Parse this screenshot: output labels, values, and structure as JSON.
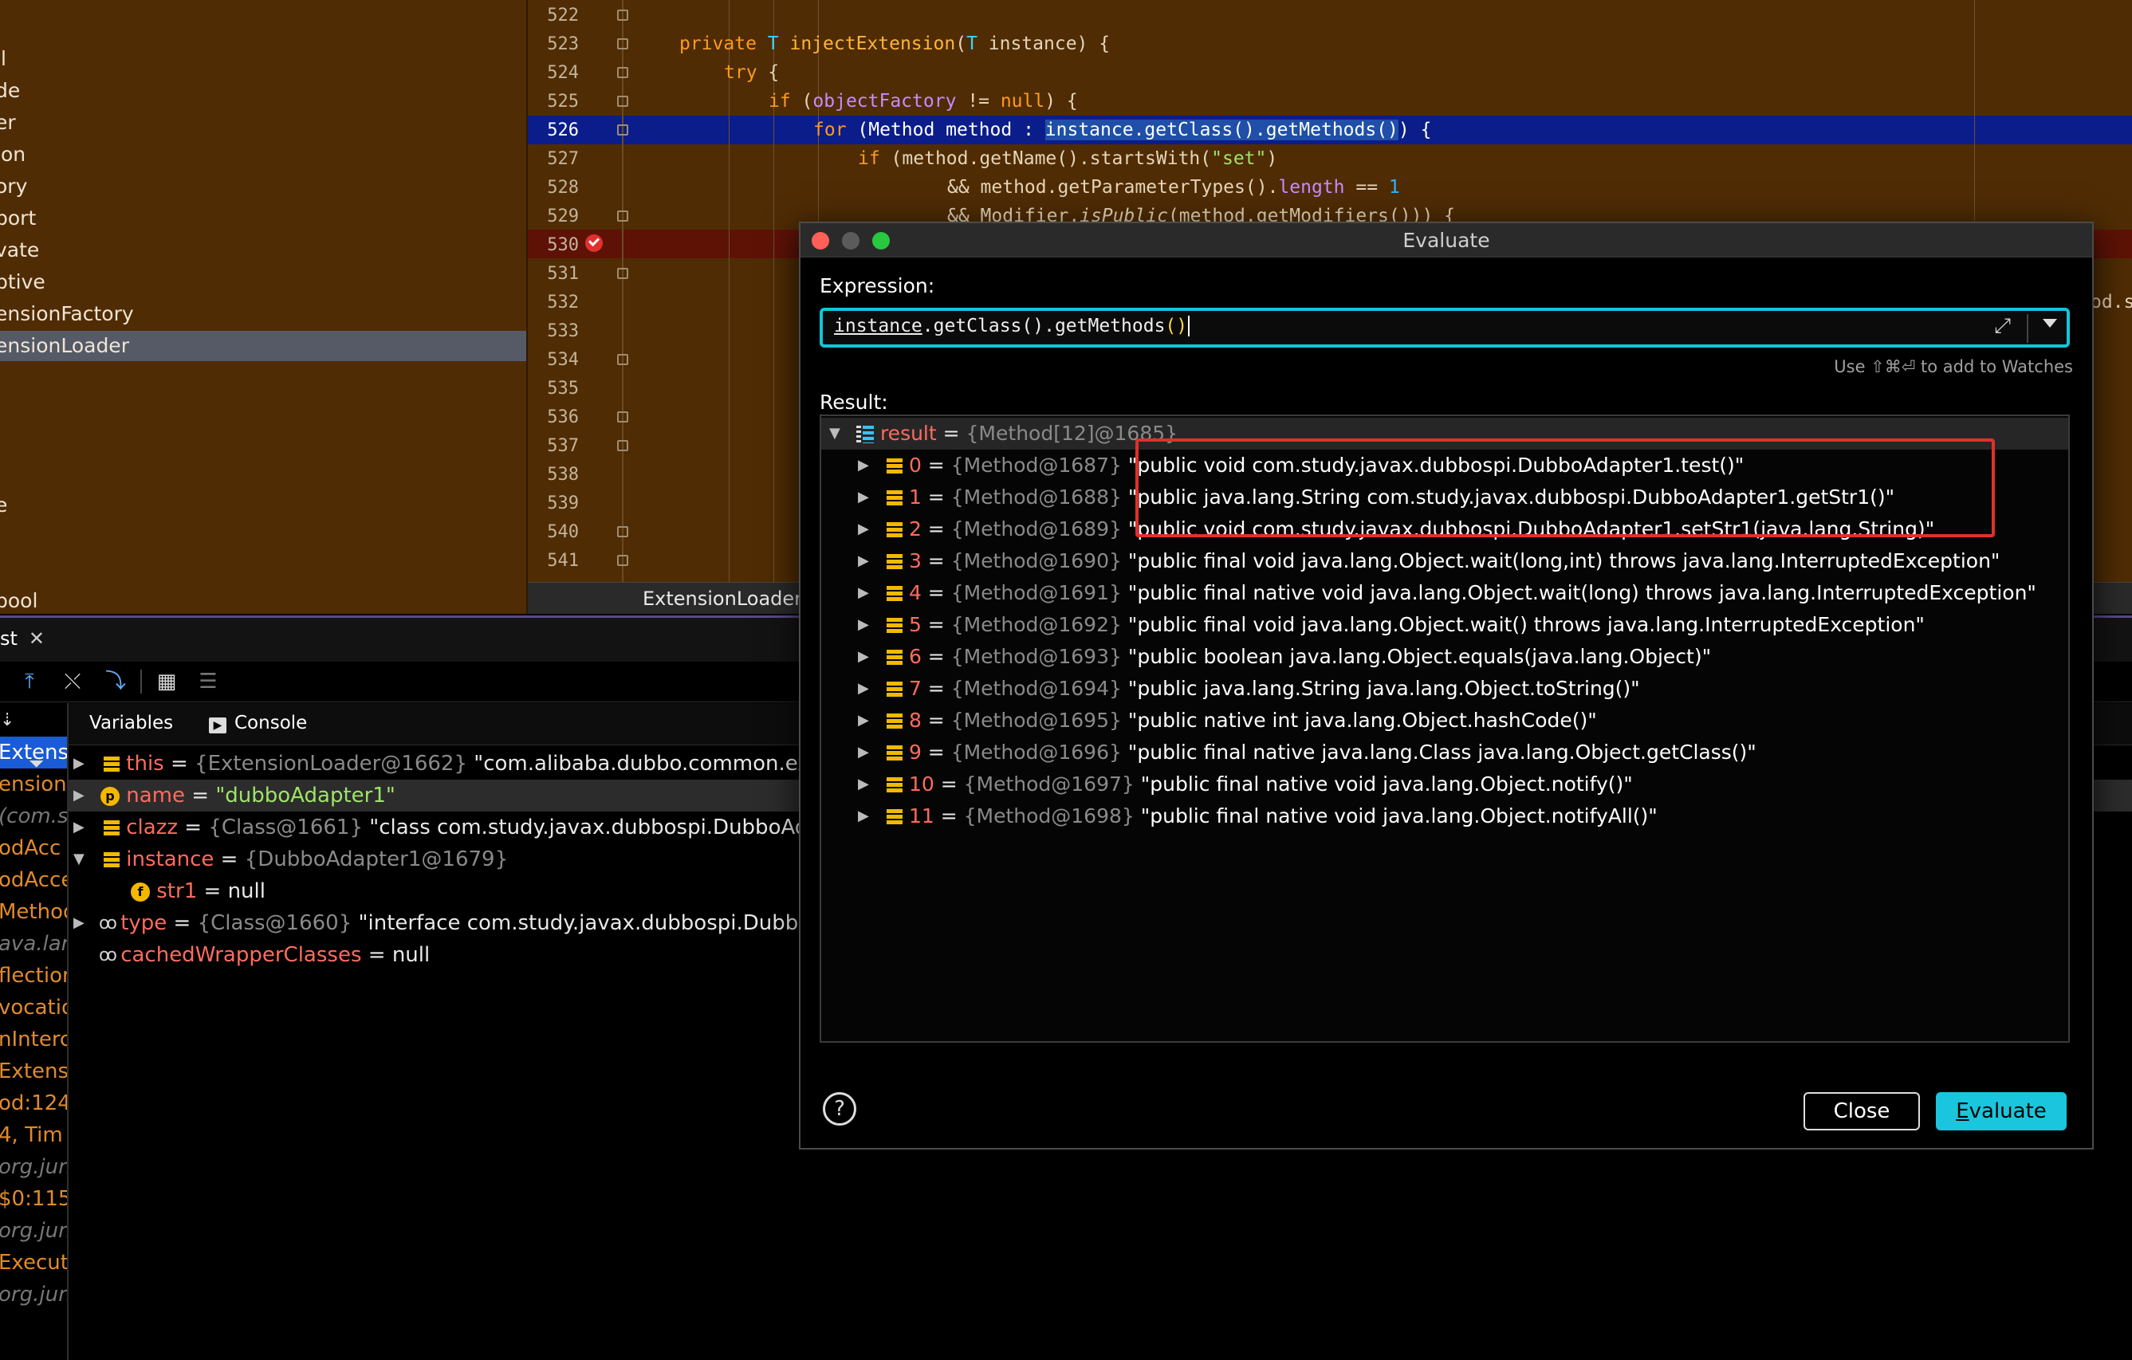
{
  "project_tree": {
    "items": [
      {
        "label": "il"
      },
      {
        "label": "de"
      },
      {
        "label": "er"
      },
      {
        "label": "ion"
      },
      {
        "label": "ory"
      },
      {
        "label": "port"
      },
      {
        "label": "vate"
      },
      {
        "label": "ptive"
      },
      {
        "label": "ensionFactory"
      },
      {
        "label": "ensionLoader"
      },
      {
        "label": "e"
      },
      {
        "label": "pool"
      }
    ]
  },
  "editor": {
    "line_numbers": [
      "522",
      "523",
      "524",
      "525",
      "526",
      "527",
      "528",
      "529",
      "530",
      "531",
      "532",
      "533",
      "534",
      "535",
      "536",
      "537",
      "538",
      "539",
      "540",
      "541"
    ],
    "lines": {
      "l523": {
        "kw1": "private ",
        "ty1": "T ",
        "fn": "injectExtension",
        "p1": "(",
        "ty2": "T",
        "rest": " instance) {"
      },
      "l524": {
        "kw": "try",
        "rest": " {"
      },
      "l525": {
        "kw": "if",
        "a": " (",
        "fld": "objectFactory",
        "b": " != ",
        "kw2": "null",
        "c": ") {"
      },
      "l526": {
        "kw": "for",
        "a": " (Method method : ",
        "sel": "instance.getClass().getMethods()",
        "b": ") {"
      },
      "l527": {
        "kw": "if",
        "a": " (method.getName().startsWith(",
        "str": "\"set\"",
        "b": ")"
      },
      "l528": {
        "a": "&& method.getParameterTypes().",
        "fld": "length",
        "b": " == ",
        "num": "1"
      },
      "l529": {
        "a": "&& Modifier.",
        "it": "isPublic",
        "b": "(method.getModifiers())) {"
      }
    },
    "right_clip": "od.s",
    "tab_label": "ExtensionLoader"
  },
  "debug": {
    "tab_label": "st",
    "tabs": {
      "variables": "Variables",
      "console": "Console"
    },
    "frames": [
      "Extensi",
      "ensionL",
      "(com.s",
      "odAcc",
      "odAcce",
      "Method",
      "ava.lang",
      "flection",
      "vocatio",
      "nInterc",
      "Extens",
      "od:124",
      "4, Tim",
      "org.juni",
      "$0:115,",
      "org.juni",
      "Execut",
      "org.juni"
    ],
    "variables": [
      {
        "name": "this",
        "ref": "{ExtensionLoader@1662}",
        "value": "\"com.alibaba.dubbo.common.exte"
      },
      {
        "name": "name",
        "eq": " = ",
        "str": "\"dubboAdapter1\""
      },
      {
        "name": "clazz",
        "ref": "{Class@1661}",
        "value": "\"class com.study.javax.dubbospi.DubboAda"
      },
      {
        "name": "instance",
        "ref": "{DubboAdapter1@1679}"
      },
      {
        "name": "str1",
        "value": "null"
      },
      {
        "name": "type",
        "ref": "{Class@1660}",
        "value": "\"interface com.study.javax.dubbospi.DubboS"
      },
      {
        "name": "cachedWrapperClasses",
        "value": "null"
      }
    ],
    "eq": " = "
  },
  "dialog": {
    "title": "Evaluate",
    "expression_label": "Expression:",
    "expression": {
      "u": "instance",
      "rest": ".getClass().getMethods",
      "paren": "()"
    },
    "hint": "Use ⇧⌘⏎ to add to Watches",
    "result_label": "Result:",
    "result_root": {
      "name": "result",
      "eq": " = ",
      "ref": "{Method[12]@1685}"
    },
    "results": [
      {
        "idx": "0",
        "ref": "{Method@1687}",
        "value": "\"public void com.study.javax.dubbospi.DubboAdapter1.test()\""
      },
      {
        "idx": "1",
        "ref": "{Method@1688}",
        "value": "\"public java.lang.String com.study.javax.dubbospi.DubboAdapter1.getStr1()\""
      },
      {
        "idx": "2",
        "ref": "{Method@1689}",
        "value": "\"public void com.study.javax.dubbospi.DubboAdapter1.setStr1(java.lang.String)\""
      },
      {
        "idx": "3",
        "ref": "{Method@1690}",
        "value": "\"public final void java.lang.Object.wait(long,int) throws java.lang.InterruptedException\""
      },
      {
        "idx": "4",
        "ref": "{Method@1691}",
        "value": "\"public final native void java.lang.Object.wait(long) throws java.lang.InterruptedException\""
      },
      {
        "idx": "5",
        "ref": "{Method@1692}",
        "value": "\"public final void java.lang.Object.wait() throws java.lang.InterruptedException\""
      },
      {
        "idx": "6",
        "ref": "{Method@1693}",
        "value": "\"public boolean java.lang.Object.equals(java.lang.Object)\""
      },
      {
        "idx": "7",
        "ref": "{Method@1694}",
        "value": "\"public java.lang.String java.lang.Object.toString()\""
      },
      {
        "idx": "8",
        "ref": "{Method@1695}",
        "value": "\"public native int java.lang.Object.hashCode()\""
      },
      {
        "idx": "9",
        "ref": "{Method@1696}",
        "value": "\"public final native java.lang.Class java.lang.Object.getClass()\""
      },
      {
        "idx": "10",
        "ref": "{Method@1697}",
        "value": "\"public final native void java.lang.Object.notify()\""
      },
      {
        "idx": "11",
        "ref": "{Method@1698}",
        "value": "\"public final native void java.lang.Object.notifyAll()\""
      }
    ],
    "result_eq": " = ",
    "help": "?",
    "close_label": "Close",
    "evaluate_label": {
      "u": "E",
      "rest": "valuate"
    }
  },
  "colors": {
    "editor_bg": "#4f2c04",
    "accent_cyan": "#19c6dd",
    "highlight_red_box": "#e0302a",
    "current_line": "#0b1d8a"
  }
}
